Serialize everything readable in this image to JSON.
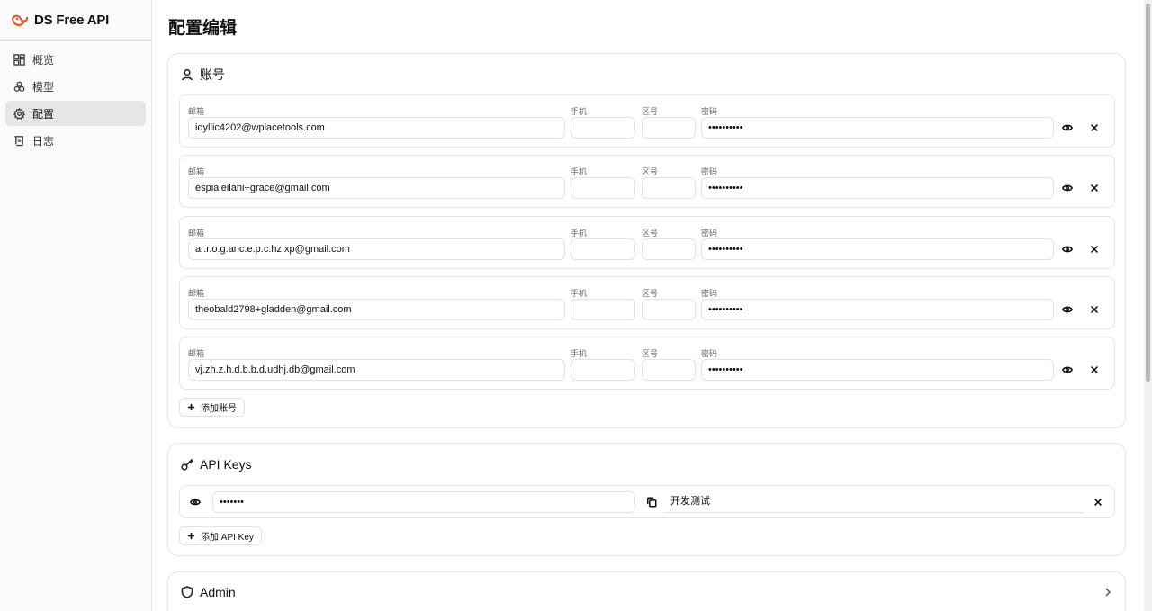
{
  "brand": {
    "title": "DS Free API",
    "accent": "#e8562a"
  },
  "nav": [
    {
      "label": "概览",
      "icon": "grid-icon"
    },
    {
      "label": "模型",
      "icon": "boxes-icon"
    },
    {
      "label": "配置",
      "icon": "gear-icon",
      "active": true
    },
    {
      "label": "日志",
      "icon": "scroll-icon"
    }
  ],
  "page": {
    "title": "配置编辑"
  },
  "accounts": {
    "title": "账号",
    "labels": {
      "email": "邮箱",
      "phone": "手机",
      "area": "区号",
      "password": "密码"
    },
    "items": [
      {
        "email": "idyllic4202@wplacetools.com",
        "phone": "",
        "area": "",
        "password": "••••••••••"
      },
      {
        "email": "espialeilani+grace@gmail.com",
        "phone": "",
        "area": "",
        "password": "••••••••••"
      },
      {
        "email": "ar.r.o.g.anc.e.p.c.hz.xp@gmail.com",
        "phone": "",
        "area": "",
        "password": "••••••••••"
      },
      {
        "email": "theobald2798+gladden@gmail.com",
        "phone": "",
        "area": "",
        "password": "••••••••••"
      },
      {
        "email": "vj.zh.z.h.d.b.b.d.udhj.db@gmail.com",
        "phone": "",
        "area": "",
        "password": "••••••••••"
      }
    ],
    "add_label": "添加账号"
  },
  "api_keys": {
    "title": "API Keys",
    "items": [
      {
        "key": "•••••••",
        "name": "开发测试"
      }
    ],
    "add_label": "添加 API Key"
  },
  "admin": {
    "title": "Admin"
  }
}
